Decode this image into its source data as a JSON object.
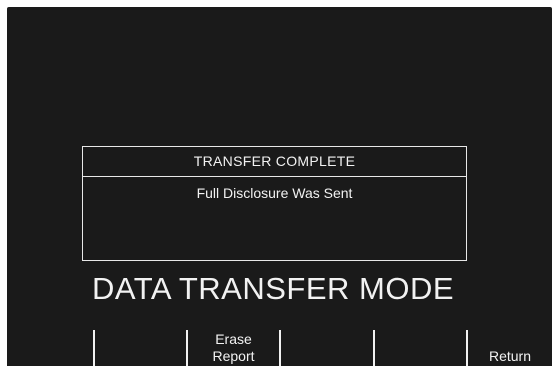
{
  "dialog": {
    "title": "TRANSFER COMPLETE",
    "message": "Full Disclosure Was Sent"
  },
  "mode_title": "DATA TRANSFER MODE",
  "softkeys": [
    {
      "line1": "",
      "line2": ""
    },
    {
      "line1": "",
      "line2": ""
    },
    {
      "line1": "Erase",
      "line2": "Report"
    },
    {
      "line1": "",
      "line2": ""
    },
    {
      "line1": "",
      "line2": ""
    },
    {
      "line1": "",
      "line2": "Return"
    }
  ],
  "colors": {
    "background": "#1a1a1a",
    "foreground": "#f2f2f2"
  }
}
